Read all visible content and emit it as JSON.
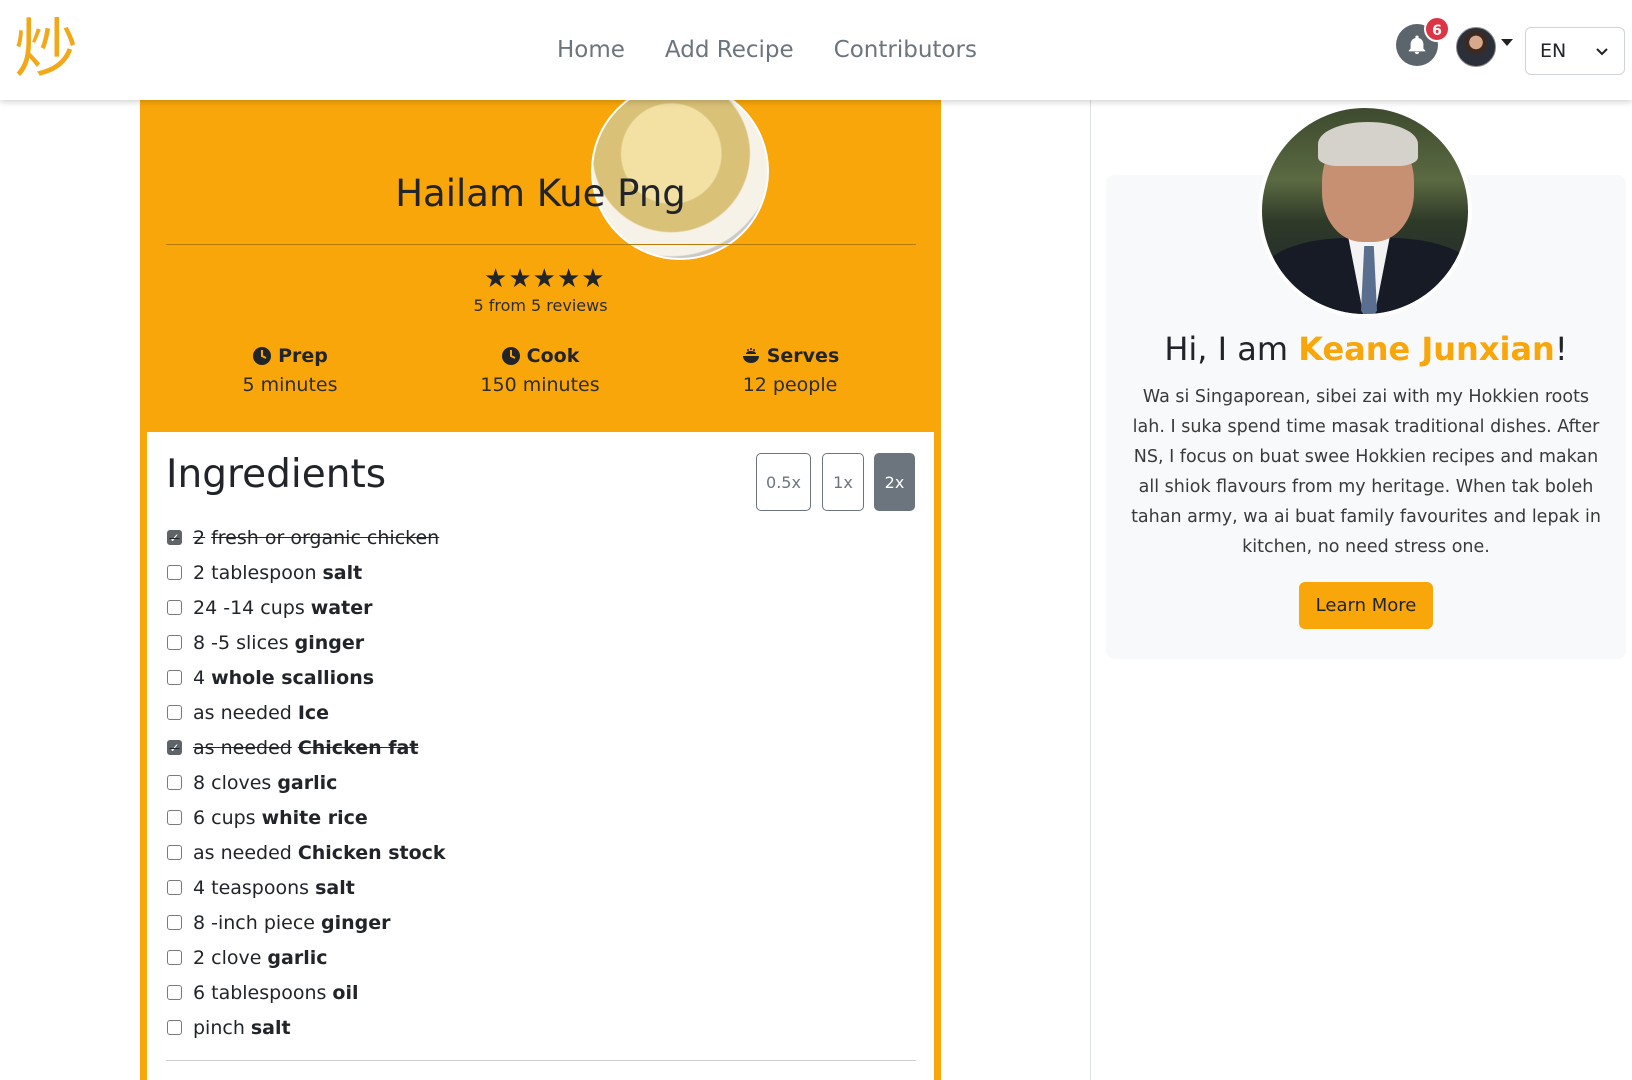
{
  "nav": {
    "logo_char": "炒",
    "links": [
      "Home",
      "Add Recipe",
      "Contributors"
    ],
    "notification_count": "6",
    "language": "EN"
  },
  "recipe": {
    "title": "Hailam Kue Png",
    "rating_stars": 5,
    "reviews_text": "5 from 5 reviews",
    "prep_label": "Prep",
    "prep_value": "5 minutes",
    "cook_label": "Cook",
    "cook_value": "150 minutes",
    "serves_label": "Serves",
    "serves_value": "12 people"
  },
  "ingredients": {
    "title": "Ingredients",
    "scales": [
      "0.5x",
      "1x",
      "2x"
    ],
    "active_scale": "2x",
    "items": [
      {
        "qty": "2",
        "name": "fresh or organic chicken",
        "checked": true,
        "bold_name": false
      },
      {
        "qty": "2 tablespoon",
        "name": "salt",
        "checked": false,
        "bold_name": true
      },
      {
        "qty": "24 -14 cups",
        "name": "water",
        "checked": false,
        "bold_name": true
      },
      {
        "qty": "8 -5 slices",
        "name": "ginger",
        "checked": false,
        "bold_name": true
      },
      {
        "qty": "4",
        "name": "whole scallions",
        "checked": false,
        "bold_name": true
      },
      {
        "qty": "as needed",
        "name": "Ice",
        "checked": false,
        "bold_name": true
      },
      {
        "qty": "as needed",
        "name": "Chicken fat",
        "checked": true,
        "bold_name": true
      },
      {
        "qty": "8 cloves",
        "name": "garlic",
        "checked": false,
        "bold_name": true
      },
      {
        "qty": "6 cups",
        "name": "white rice",
        "checked": false,
        "bold_name": true
      },
      {
        "qty": "as needed",
        "name": "Chicken stock",
        "checked": false,
        "bold_name": true
      },
      {
        "qty": "4 teaspoons",
        "name": "salt",
        "checked": false,
        "bold_name": true
      },
      {
        "qty": "8 -inch piece",
        "name": "ginger",
        "checked": false,
        "bold_name": true
      },
      {
        "qty": "2 clove",
        "name": "garlic",
        "checked": false,
        "bold_name": true
      },
      {
        "qty": "6 tablespoons",
        "name": "oil",
        "checked": false,
        "bold_name": true
      },
      {
        "qty": "pinch",
        "name": "salt",
        "checked": false,
        "bold_name": true
      }
    ]
  },
  "profile": {
    "greeting_prefix": "Hi, I am ",
    "name": "Keane Junxian",
    "greeting_suffix": "!",
    "bio": "Wa si Singaporean, sibei zai with my Hokkien roots lah. I suka spend time masak traditional dishes. After NS, I focus on buat swee Hokkien recipes and makan all shiok flavours from my heritage. When tak boleh tahan army, wa ai buat family favourites and lepak in kitchen, no need stress one.",
    "button": "Learn More"
  },
  "colors": {
    "accent": "#f9a60a",
    "badge": "#dc3545",
    "secondary": "#6c757d"
  }
}
